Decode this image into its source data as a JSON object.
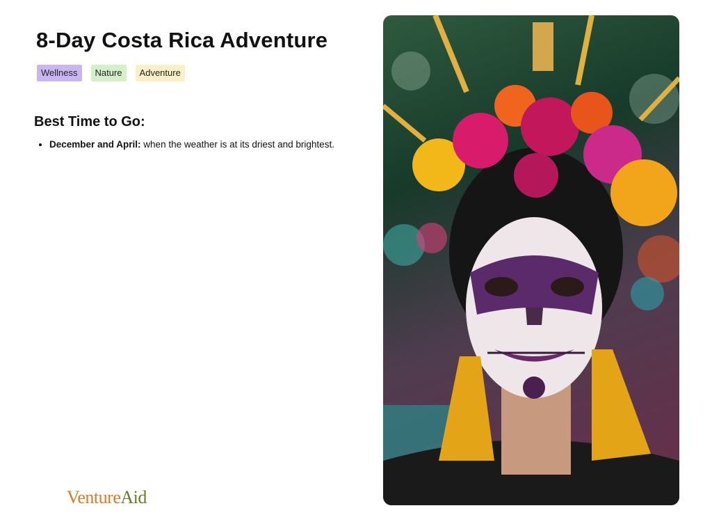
{
  "page": {
    "title": "8-Day Costa Rica Adventure",
    "tags": [
      "Wellness",
      "Nature",
      "Adventure"
    ]
  },
  "best_time": {
    "heading": "Best Time to Go:",
    "items": [
      {
        "label": "December and April:",
        "text": " when the weather is at its driest and brightest."
      }
    ]
  },
  "brand": {
    "part1": "Venture",
    "part2": "Aid"
  },
  "photo": {
    "icon": "skull-face-portrait-image"
  }
}
